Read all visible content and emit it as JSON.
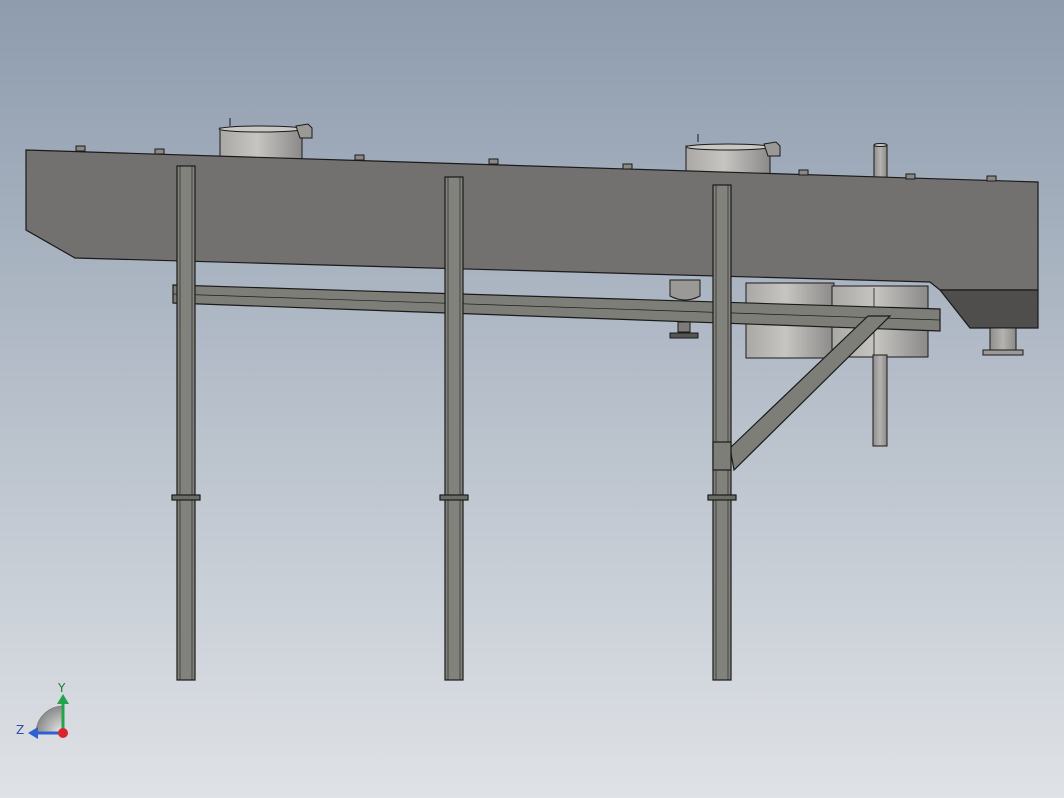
{
  "viewport": {
    "background_top": "#8e9cae",
    "background_bottom": "#dfe2e6"
  },
  "colors": {
    "trough_face": "#727170",
    "trough_dark": "#4f4e4d",
    "beam": "#7e7e78",
    "column": "#82827c",
    "cylinder_light": "#bdbcb9",
    "cylinder_mid": "#8b8a88",
    "outline": "#1a1a1a"
  },
  "triad": {
    "y_label": "Y",
    "z_label": "Z",
    "x_color": "#d9262d",
    "y_color": "#24a44a",
    "z_color": "#2f5fd0"
  }
}
